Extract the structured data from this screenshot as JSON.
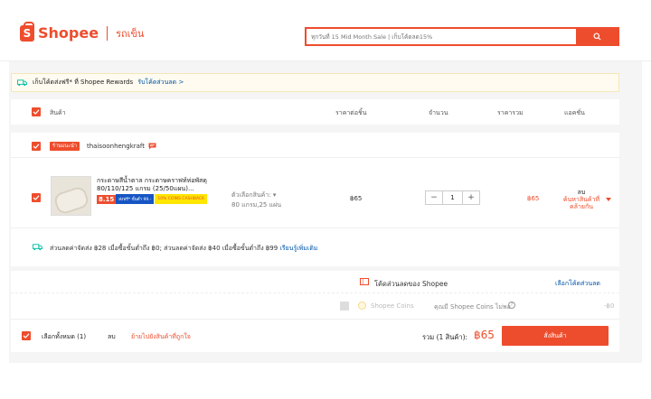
{
  "header": {
    "brand": "Shopee",
    "logo_letter": "S",
    "page_label": "รถเข็น",
    "search_placeholder": "ทุกวันที่ 15 Mid Month Sale | เก็บโค้ดลด15%",
    "search_icon": "search-icon"
  },
  "rewards": {
    "text": "เก็บโค้ดส่งฟรี* ที่ Shopee Rewards",
    "link": "รับโค้ดส่วนลด >"
  },
  "columns": {
    "product": "สินค้า",
    "unit_price": "ราคาต่อชิ้น",
    "quantity": "จำนวน",
    "total_price": "ราคารวม",
    "actions": "แอคชั่น"
  },
  "shop": {
    "badge": "ร้านแนะนำ",
    "name": "thaisoonhengkraft"
  },
  "item": {
    "title": "กระดาษสีน้ำตาล กระดาษคราฟท์ห่อพัสดุ 80/110/125 แกรม (25/50แผน)...",
    "tag_sale": "8.15",
    "tag_shipping": "ส่งฟรี* ขั้นต่ำ 99.-",
    "tag_cashback": "10% COINS CASHBACK",
    "variant_label": "ตัวเลือกสินค้า:",
    "variant_value": "80 แกรม,25 แผ่น",
    "unit_price": "฿65",
    "quantity": "1",
    "qty_minus": "−",
    "qty_plus": "+",
    "total": "฿65",
    "action_delete": "ลบ",
    "action_similar": "ค้นหาสินค้าที่คล้ายกัน"
  },
  "shipping": {
    "text": "ส่วนลดค่าจัดส่ง ฿28 เมื่อซื้อขั้นต่ำถึง ฿0; ส่วนลดค่าจัดส่ง ฿40 เมื่อซื้อขั้นต่ำถึง ฿99",
    "link": "เรียนรู้เพิ่มเติม"
  },
  "summary": {
    "voucher_label": "โค้ดส่วนลดของ Shopee",
    "voucher_link": "เลือกโค้ดส่วนลด",
    "coins_label": "Shopee Coins",
    "coins_note": "คุณมี Shopee Coins ไม่พอ",
    "coins_value": "-฿0",
    "select_all": "เลือกทั้งหมด (1)",
    "delete": "ลบ",
    "move_to_fav": "ย้ายไปยังสินค้าที่ถูกใจ",
    "total_label": "รวม (1 สินค้า):",
    "total_value": "฿65",
    "checkout": "สั่งสินค้า"
  },
  "colors": {
    "accent": "#ee4d2d",
    "link": "#0055aa"
  }
}
